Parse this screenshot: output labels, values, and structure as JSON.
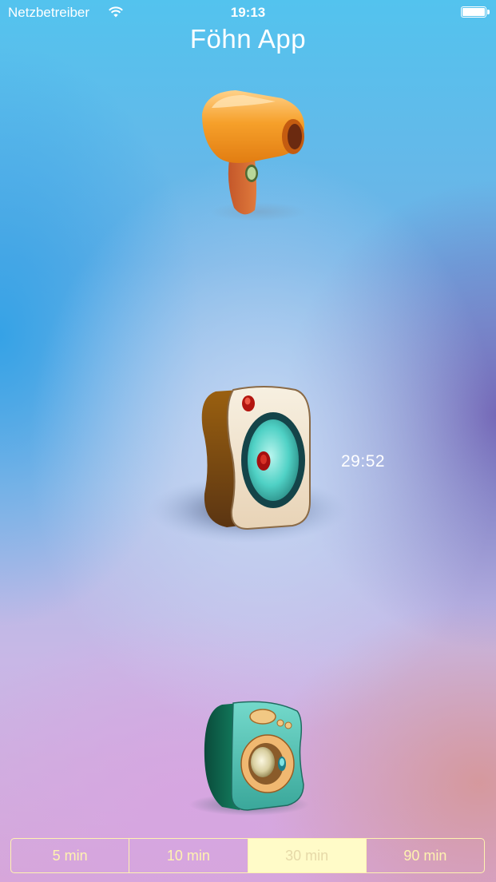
{
  "status_bar": {
    "carrier": "Netzbetreiber",
    "time": "19:13",
    "wifi_icon": "wifi-icon",
    "battery_icon": "battery-icon"
  },
  "app": {
    "title": "Föhn App"
  },
  "appliances": [
    {
      "name": "hairdryer",
      "icon": "hairdryer-icon"
    },
    {
      "name": "heater",
      "icon": "fan-heater-icon",
      "timer": "29:52"
    },
    {
      "name": "washing-machine",
      "icon": "washing-machine-icon"
    }
  ],
  "duration_picker": {
    "options": [
      "5 min",
      "10 min",
      "30 min",
      "90 min"
    ],
    "selected": "30 min"
  },
  "colors": {
    "segment_tint": "#fff3b0",
    "selected_segment_bg": "#fffbc8",
    "dryer_orange": "#f39a1e",
    "heater_teal": "#4fd1c5",
    "washer_teal": "#55c7b9"
  }
}
